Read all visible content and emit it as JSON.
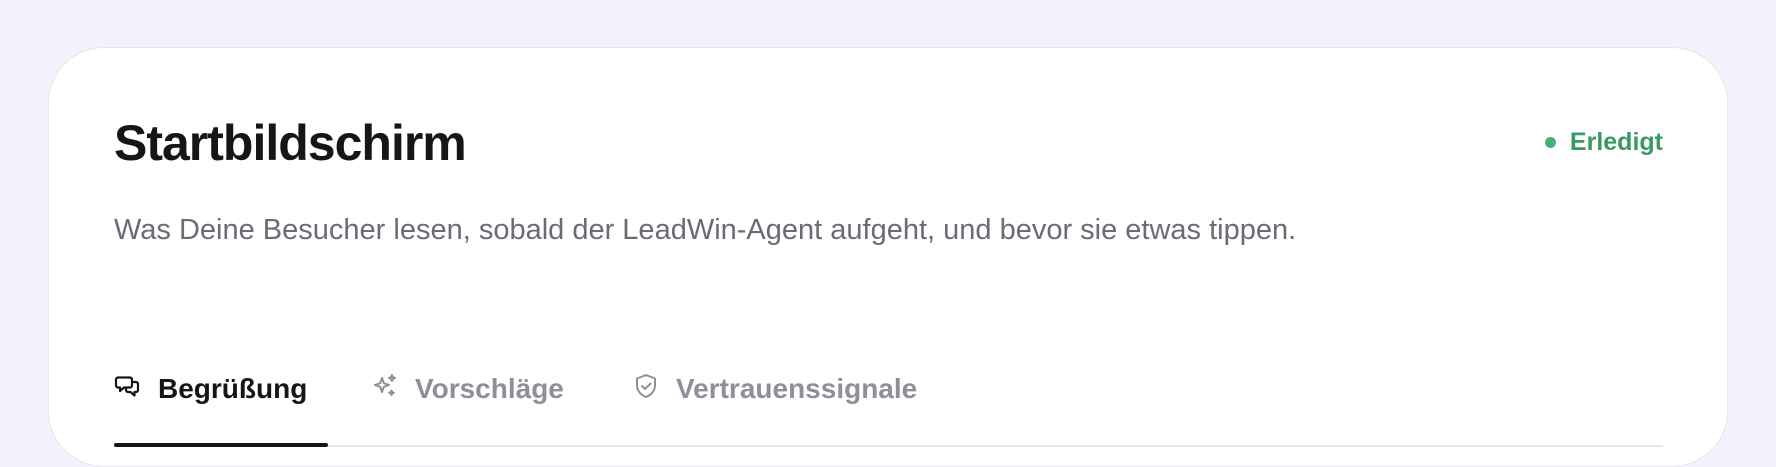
{
  "screen": {
    "title": "Startbildschirm",
    "subtitle": "Was Deine Besucher lesen, sobald der LeadWin-Agent aufgeht, und bevor sie etwas tippen.",
    "status": {
      "label": "Erledigt",
      "color": "#3a9a63"
    }
  },
  "tabs": [
    {
      "label": "Begrüßung",
      "icon": "chat-bubbles-icon",
      "active": true
    },
    {
      "label": "Vorschläge",
      "icon": "sparkles-icon",
      "active": false
    },
    {
      "label": "Vertrauenssignale",
      "icon": "shield-check-icon",
      "active": false
    }
  ],
  "colors": {
    "background": "#f3f2fc",
    "card": "#ffffff",
    "text_primary": "#16161a",
    "text_secondary": "#6b6b76",
    "tab_inactive": "#8f8f99",
    "success": "#4cb074"
  }
}
